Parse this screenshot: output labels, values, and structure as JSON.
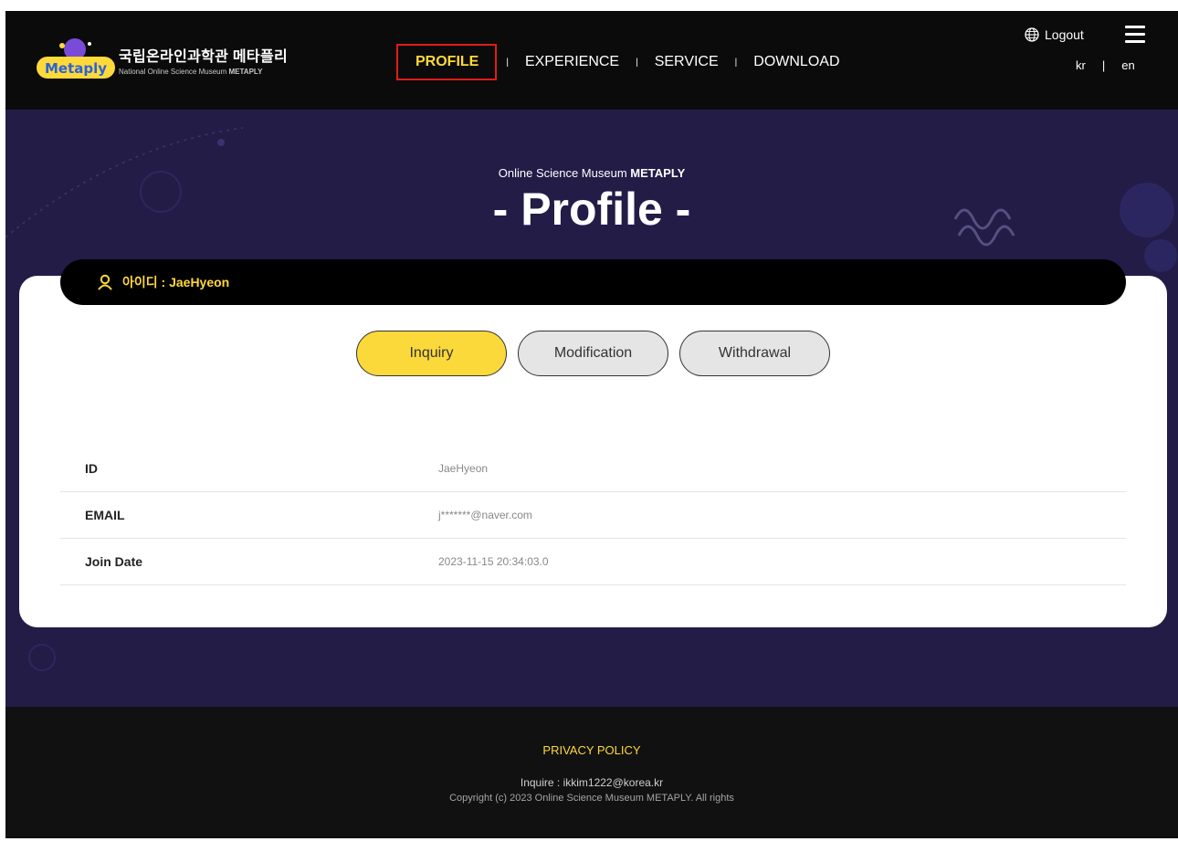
{
  "header": {
    "logo_kr": "국립온라인과학관 메타플리",
    "logo_en_prefix": "National Online Science Museum",
    "logo_en_bold": "METAPLY",
    "logo_badge": "Metaply",
    "nav": [
      "PROFILE",
      "EXPERIENCE",
      "SERVICE",
      "DOWNLOAD"
    ],
    "logout": "Logout",
    "lang": [
      "kr",
      "en"
    ],
    "icons": {
      "globe": "globe-icon",
      "menu": "hamburger-menu-icon",
      "user": "user-icon"
    }
  },
  "hero": {
    "subtitle_prefix": "Online Science Museum",
    "subtitle_bold": "METAPLY",
    "title": "- Profile -"
  },
  "user": {
    "label": "아이디 : JaeHyeon"
  },
  "tabs": [
    "Inquiry",
    "Modification",
    "Withdrawal"
  ],
  "info": [
    {
      "key": "ID",
      "value": "JaeHyeon"
    },
    {
      "key": "EMAIL",
      "value": "j*******@naver.com"
    },
    {
      "key": "Join Date",
      "value": "2023-11-15 20:34:03.0"
    }
  ],
  "footer": {
    "policy": "PRIVACY POLICY",
    "inquire": "Inquire : ikkim1222@korea.kr",
    "copyright": "Copyright (c) 2023 Online Science Museum METAPLY. All rights"
  },
  "colors": {
    "accent": "#ffd93a",
    "hero_bg": "#221c47",
    "header_bg": "#0b0b0b",
    "active_outline": "#e11b1b"
  }
}
